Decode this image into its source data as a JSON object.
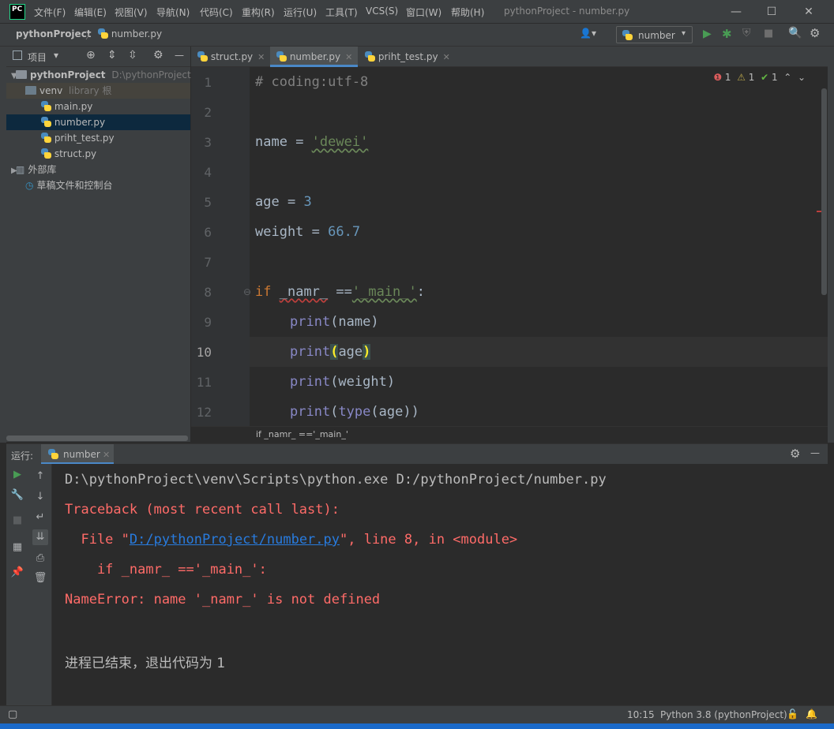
{
  "titlebar": {
    "logo": "PC",
    "menus": [
      "文件(F)",
      "编辑(E)",
      "视图(V)",
      "导航(N)",
      "代码(C)",
      "重构(R)",
      "运行(U)",
      "工具(T)",
      "VCS(S)",
      "窗口(W)",
      "帮助(H)"
    ],
    "window_title": "pythonProject - number.py",
    "minimize": "—",
    "maximize": "☐",
    "close": "✕"
  },
  "navbar": {
    "project": "pythonProject",
    "separator": "〉",
    "file": "number.py",
    "run_config": "number",
    "user_icon": "👤▾",
    "run_icon": "▶",
    "debug_icon": "✱",
    "coverage_icon": "⛨",
    "stop_icon": "■",
    "search_icon": "🔍",
    "settings_icon": "⚙"
  },
  "project_panel": {
    "title": "项目",
    "dropdown": "▾",
    "target_icon": "⊕",
    "expand_icon": "⇕",
    "collapse_icon": "⇳",
    "gear_icon": "⚙",
    "hide_icon": "—",
    "root_name": "pythonProject",
    "root_path": "D:\\pythonProject",
    "venv_name": "venv",
    "venv_tag": "library 根",
    "files": [
      "main.py",
      "number.py",
      "priht_test.py",
      "struct.py"
    ],
    "external_libs": "外部库",
    "scratches": "草稿文件和控制台"
  },
  "tabs": [
    {
      "label": "struct.py",
      "close": "✕"
    },
    {
      "label": "number.py",
      "close": "✕"
    },
    {
      "label": "priht_test.py",
      "close": "✕"
    }
  ],
  "editor": {
    "line_numbers": [
      "1",
      "2",
      "3",
      "4",
      "5",
      "6",
      "7",
      "8",
      "9",
      "10",
      "11",
      "12"
    ],
    "current_line": "10",
    "inspection": {
      "errors": "1",
      "warnings": "1",
      "typos": "1",
      "up": "⌃",
      "down": "⌄"
    },
    "breadcrumb": "if _namr_ =='_main_'",
    "code": {
      "l1": "# coding:utf-8",
      "l3_name": "name",
      "l3_eq": " = ",
      "l3_str": "'dewei'",
      "l5_name": "age",
      "l5_eq": " = ",
      "l5_num": "3",
      "l6_name": "weight",
      "l6_eq": " = ",
      "l6_num": "66.7",
      "l8_if": "if",
      "l8_sp": " ",
      "l8_var": "_namr_",
      "l8_eq": " ==",
      "l8_str": "'_main_'",
      "l8_colon": ":",
      "print": "print",
      "l9_args": "(name)",
      "l10_open": "(",
      "l10_arg": "age",
      "l10_close": ")",
      "l11_args": "(weight)",
      "l12_open": "(",
      "l12_type": "type",
      "l12_rest": "(age))"
    }
  },
  "run_panel": {
    "label": "运行:",
    "tab": "number",
    "tab_close": "✕",
    "gear": "⚙",
    "hide": "—",
    "console": {
      "cmd": "D:\\pythonProject\\venv\\Scripts\\python.exe D:/pythonProject/number.py",
      "traceback": "Traceback (most recent call last):",
      "file_prefix": "  File \"",
      "file_link": "D:/pythonProject/number.py",
      "file_suffix": "\", line 8, in <module>",
      "code_line": "    if _namr_ =='_main_':",
      "error": "NameError: name '_namr_' is not defined",
      "exit": "进程已结束，退出代码为 1"
    },
    "toolbar": {
      "rerun": "▶",
      "up": "↑",
      "wrench": "🔧",
      "down": "↓",
      "stop": "■",
      "wrap": "↵",
      "scroll_end": "⇊",
      "layout": "▦",
      "print": "⎙",
      "pin": "📌",
      "trash": "🗑"
    }
  },
  "statusbar": {
    "toggle_icon": "▢",
    "position": "10:15",
    "interpreter": "Python 3.8 (pythonProject)",
    "lock_icon": "🔓",
    "bell_icon": "🔔"
  },
  "colors": {
    "bg": "#2b2b2b",
    "panel": "#3c3f41",
    "keyword": "#cc7832",
    "string": "#6a8759",
    "number": "#6897bb",
    "builtin": "#8888c6",
    "error_text": "#ff6b68",
    "link": "#287bde"
  }
}
